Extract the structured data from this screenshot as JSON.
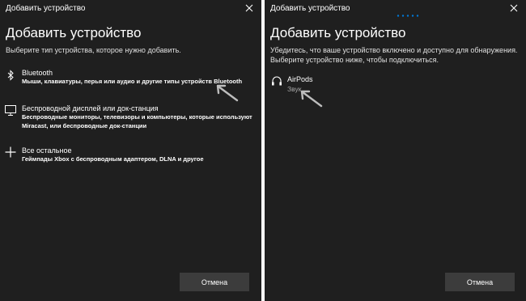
{
  "dialog_left": {
    "window_title": "Добавить устройство",
    "heading": "Добавить устройство",
    "subtitle": "Выберите тип устройства, которое нужно добавить.",
    "options": [
      {
        "label": "Bluetooth",
        "description": "Мыши, клавиатуры, перья или аудио и другие типы устройств Bluetooth",
        "icon": "bluetooth-icon"
      },
      {
        "label": "Беспроводной дисплей или док-станция",
        "description": "Беспроводные мониторы, телевизоры и компьютеры, которые используют Miracast, или беспроводные док-станции",
        "icon": "monitor-icon"
      },
      {
        "label": "Все остальное",
        "description": "Геймпады Xbox с беспроводным адаптером, DLNA и другое",
        "icon": "plus-icon"
      }
    ],
    "cancel_label": "Отмена"
  },
  "dialog_right": {
    "window_title": "Добавить устройство",
    "heading": "Добавить устройство",
    "subtitle_line1": "Убедитесь, что ваше устройство включено и доступно для обнаружения.",
    "subtitle_line2": "Выберите устройство ниже, чтобы подключиться.",
    "device": {
      "name": "AirPods",
      "type": "Звук",
      "icon": "headphones-icon"
    },
    "cancel_label": "Отмена"
  },
  "colors": {
    "dialog_bg": "#1f1f1f",
    "button_bg": "#3c3c3c",
    "accent": "#0078d7",
    "secondary_text": "#a8a8a8"
  }
}
